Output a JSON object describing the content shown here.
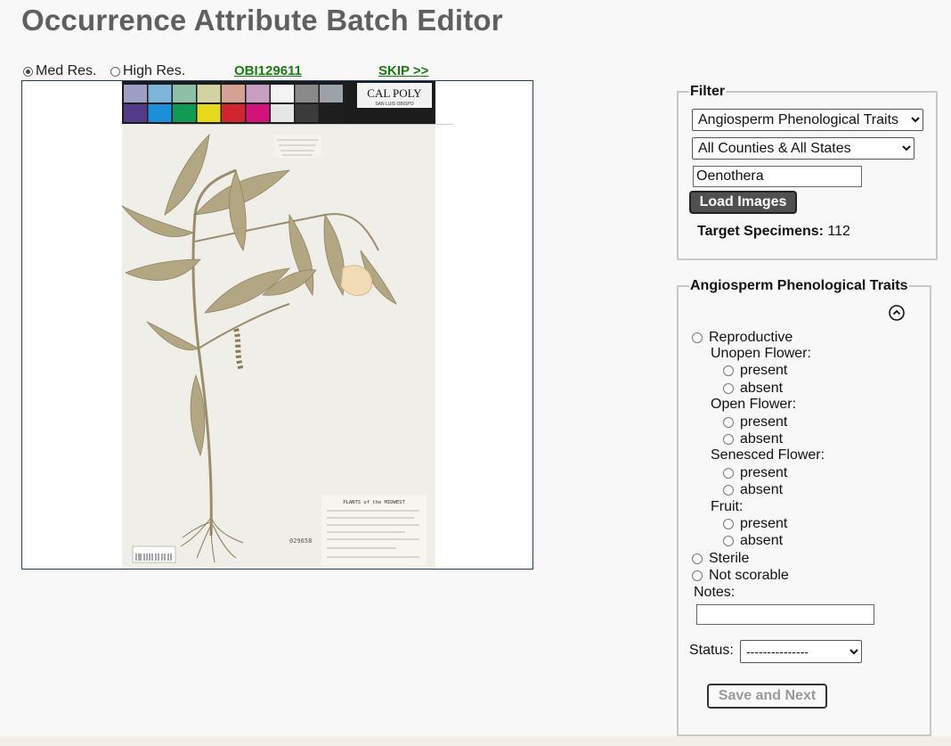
{
  "page": {
    "title": "Occurrence Attribute Batch Editor"
  },
  "toolbar": {
    "med_res_label": "Med Res.",
    "high_res_label": "High Res.",
    "med_res_checked": true,
    "catalog_number": "OBI129611",
    "skip_label": "SKIP >>"
  },
  "specimen_image": {
    "logo_text": "CAL POLY",
    "logo_sub": "SAN LUIS OBISPO",
    "label_text": "PLANTS of the MIDWEST",
    "sheet_number": "029658",
    "colors_top": [
      "#9f9fc6",
      "#7eb6d9",
      "#8fbfa7",
      "#d3d2a2",
      "#d6a195",
      "#c89ec2",
      "#f3f3f3",
      "#8a8a8a",
      "#9ca2a7"
    ],
    "colors_bottom": [
      "#553a8a",
      "#1d8fd8",
      "#129a52",
      "#e6d81b",
      "#d1262f",
      "#d4137a",
      "#e6e6e6",
      "#3b3b3b",
      "#1e1e1e"
    ]
  },
  "filter": {
    "legend": "Filter",
    "trait_select": "Angiosperm Phenological Traits",
    "region_select": "All Counties & All States",
    "taxa_value": "Oenothera",
    "load_button": "Load Images",
    "target_label": "Target Specimens:",
    "target_count": "112"
  },
  "traits": {
    "legend": "Angiosperm Phenological Traits",
    "reproductive": "Reproductive",
    "unopen_flower": "Unopen Flower:",
    "open_flower": "Open Flower:",
    "senesced_flower": "Senesced Flower:",
    "fruit": "Fruit:",
    "present": "present",
    "absent": "absent",
    "sterile": "Sterile",
    "not_scorable": "Not scorable",
    "notes_label": "Notes:",
    "notes_value": "",
    "status_label": "Status:",
    "status_select": "---------------",
    "save_button": "Save and Next"
  }
}
